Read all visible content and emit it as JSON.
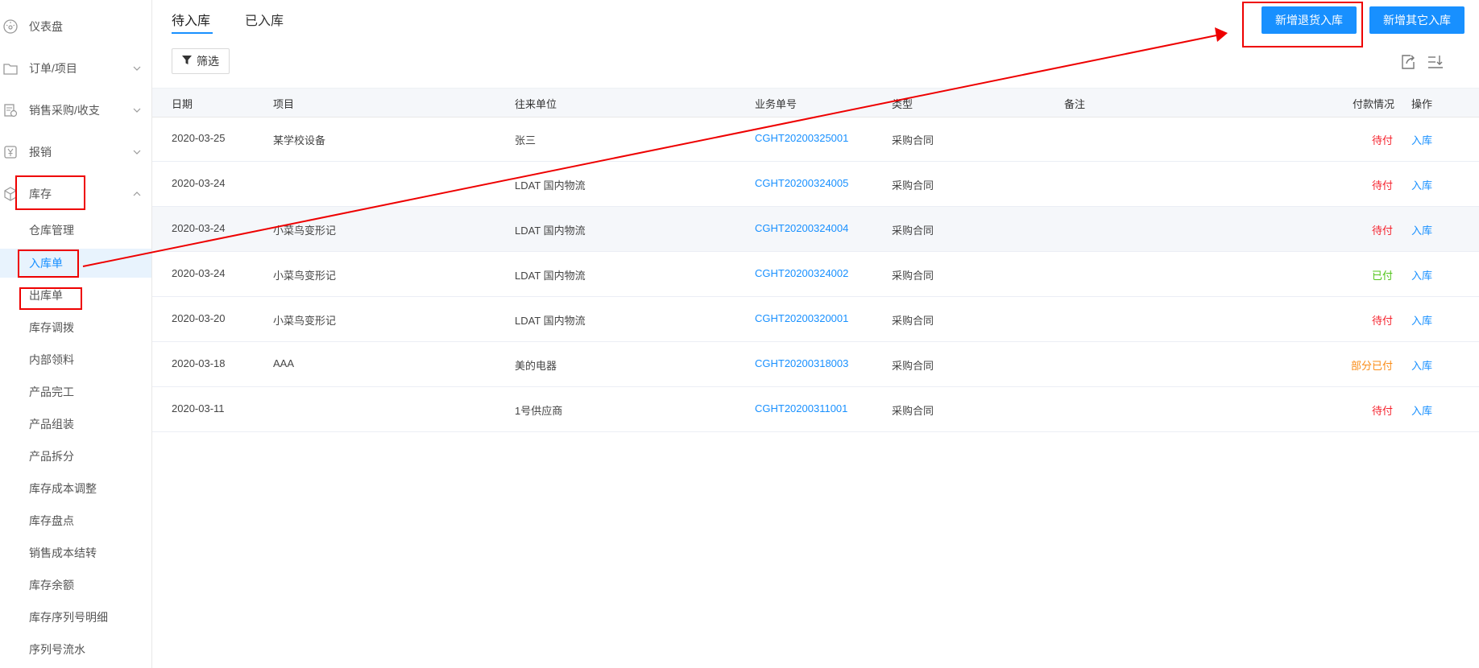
{
  "sidebar": {
    "items": [
      {
        "label": "仪表盘",
        "icon": "dashboard-icon"
      },
      {
        "label": "订单/项目",
        "icon": "folder-icon"
      },
      {
        "label": "销售采购/收支",
        "icon": "document-icon"
      },
      {
        "label": "报销",
        "icon": "yuan-icon"
      },
      {
        "label": "库存",
        "icon": "box-icon"
      }
    ],
    "sub_items": [
      "仓库管理",
      "入库单",
      "出库单",
      "库存调拨",
      "内部领料",
      "产品完工",
      "产品组装",
      "产品拆分",
      "库存成本调整",
      "库存盘点",
      "销售成本结转",
      "库存余额",
      "库存序列号明细",
      "序列号流水"
    ]
  },
  "tabs": [
    "待入库",
    "已入库"
  ],
  "buttons": {
    "return_in": "新增退货入库",
    "other_in": "新增其它入库",
    "filter": "筛选"
  },
  "table": {
    "headers": [
      "日期",
      "项目",
      "往来单位",
      "业务单号",
      "类型",
      "备注",
      "付款情况",
      "操作"
    ],
    "rows": [
      {
        "date": "2020-03-25",
        "project": "某学校设备",
        "partner": "张三",
        "order_no": "CGHT20200325001",
        "type": "采购合同",
        "note": "",
        "payment": "待付",
        "action": "入库"
      },
      {
        "date": "2020-03-24",
        "project": "",
        "partner": "LDAT 国内物流",
        "order_no": "CGHT20200324005",
        "type": "采购合同",
        "note": "",
        "payment": "待付",
        "action": "入库"
      },
      {
        "date": "2020-03-24",
        "project": "小菜鸟变形记",
        "partner": "LDAT 国内物流",
        "order_no": "CGHT20200324004",
        "type": "采购合同",
        "note": "",
        "payment": "待付",
        "action": "入库"
      },
      {
        "date": "2020-03-24",
        "project": "小菜鸟变形记",
        "partner": "LDAT 国内物流",
        "order_no": "CGHT20200324002",
        "type": "采购合同",
        "note": "",
        "payment": "已付",
        "action": "入库"
      },
      {
        "date": "2020-03-20",
        "project": "小菜鸟变形记",
        "partner": "LDAT 国内物流",
        "order_no": "CGHT20200320001",
        "type": "采购合同",
        "note": "",
        "payment": "待付",
        "action": "入库"
      },
      {
        "date": "2020-03-18",
        "project": "AAA",
        "partner": "美的电器",
        "order_no": "CGHT20200318003",
        "type": "采购合同",
        "note": "",
        "payment": "部分已付",
        "action": "入库"
      },
      {
        "date": "2020-03-11",
        "project": "",
        "partner": "1号供应商",
        "order_no": "CGHT20200311001",
        "type": "采购合同",
        "note": "",
        "payment": "待付",
        "action": "入库"
      }
    ]
  },
  "colors": {
    "primary": "#1890ff",
    "unpaid": "#f5222d",
    "paid": "#52c41a",
    "partial": "#fa8c16",
    "annotation": "#ee0000"
  }
}
